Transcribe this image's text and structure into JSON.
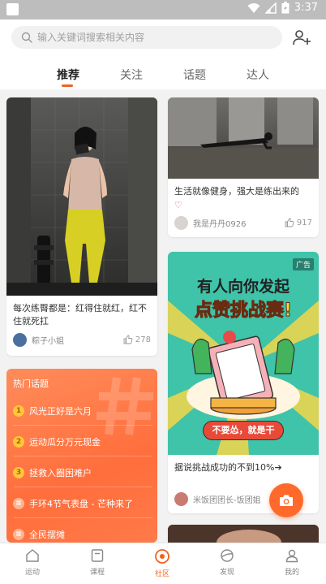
{
  "status_bar": {
    "time": "3:37"
  },
  "search": {
    "placeholder": "输入关键词搜索相关内容"
  },
  "tabs": [
    {
      "label": "推荐",
      "active": true
    },
    {
      "label": "关注",
      "active": false
    },
    {
      "label": "话题",
      "active": false
    },
    {
      "label": "达人",
      "active": false
    }
  ],
  "cards": {
    "post1": {
      "caption": "每次练臀都是：红得住就红，红不住就死扛",
      "author": "粽子小姐",
      "likes": "278"
    },
    "post2": {
      "caption": "生活就像健身，强大是练出来的",
      "author": "我是丹丹0926",
      "likes": "917"
    },
    "ad": {
      "badge": "广告",
      "banner_line1": "有人向你发起",
      "banner_line2": "点赞挑战赛!",
      "button": "不要怂，就是干",
      "caption": "据说挑战成功的不到10%➔",
      "author": "米饭团团长-饭团姐"
    }
  },
  "hot_topics": {
    "title": "热门话题",
    "items": [
      {
        "num": "1",
        "label": "风光正好是六月"
      },
      {
        "num": "2",
        "label": "运动瓜分万元现金"
      },
      {
        "num": "3",
        "label": "拯救入圈困难户"
      },
      {
        "num": "",
        "label": "手环4节气表盘 - 芒种来了"
      },
      {
        "num": "",
        "label": "全民摆摊"
      }
    ]
  },
  "bottom_nav": [
    {
      "label": "运动",
      "icon": "home-icon",
      "active": false
    },
    {
      "label": "课程",
      "icon": "course-icon",
      "active": false
    },
    {
      "label": "社区",
      "icon": "community-icon",
      "active": true
    },
    {
      "label": "发现",
      "icon": "discover-icon",
      "active": false
    },
    {
      "label": "我的",
      "icon": "profile-icon",
      "active": false
    }
  ],
  "colors": {
    "accent": "#f0621e",
    "topic_bg": "#ff6e3c",
    "fab": "#ff6a2c"
  }
}
